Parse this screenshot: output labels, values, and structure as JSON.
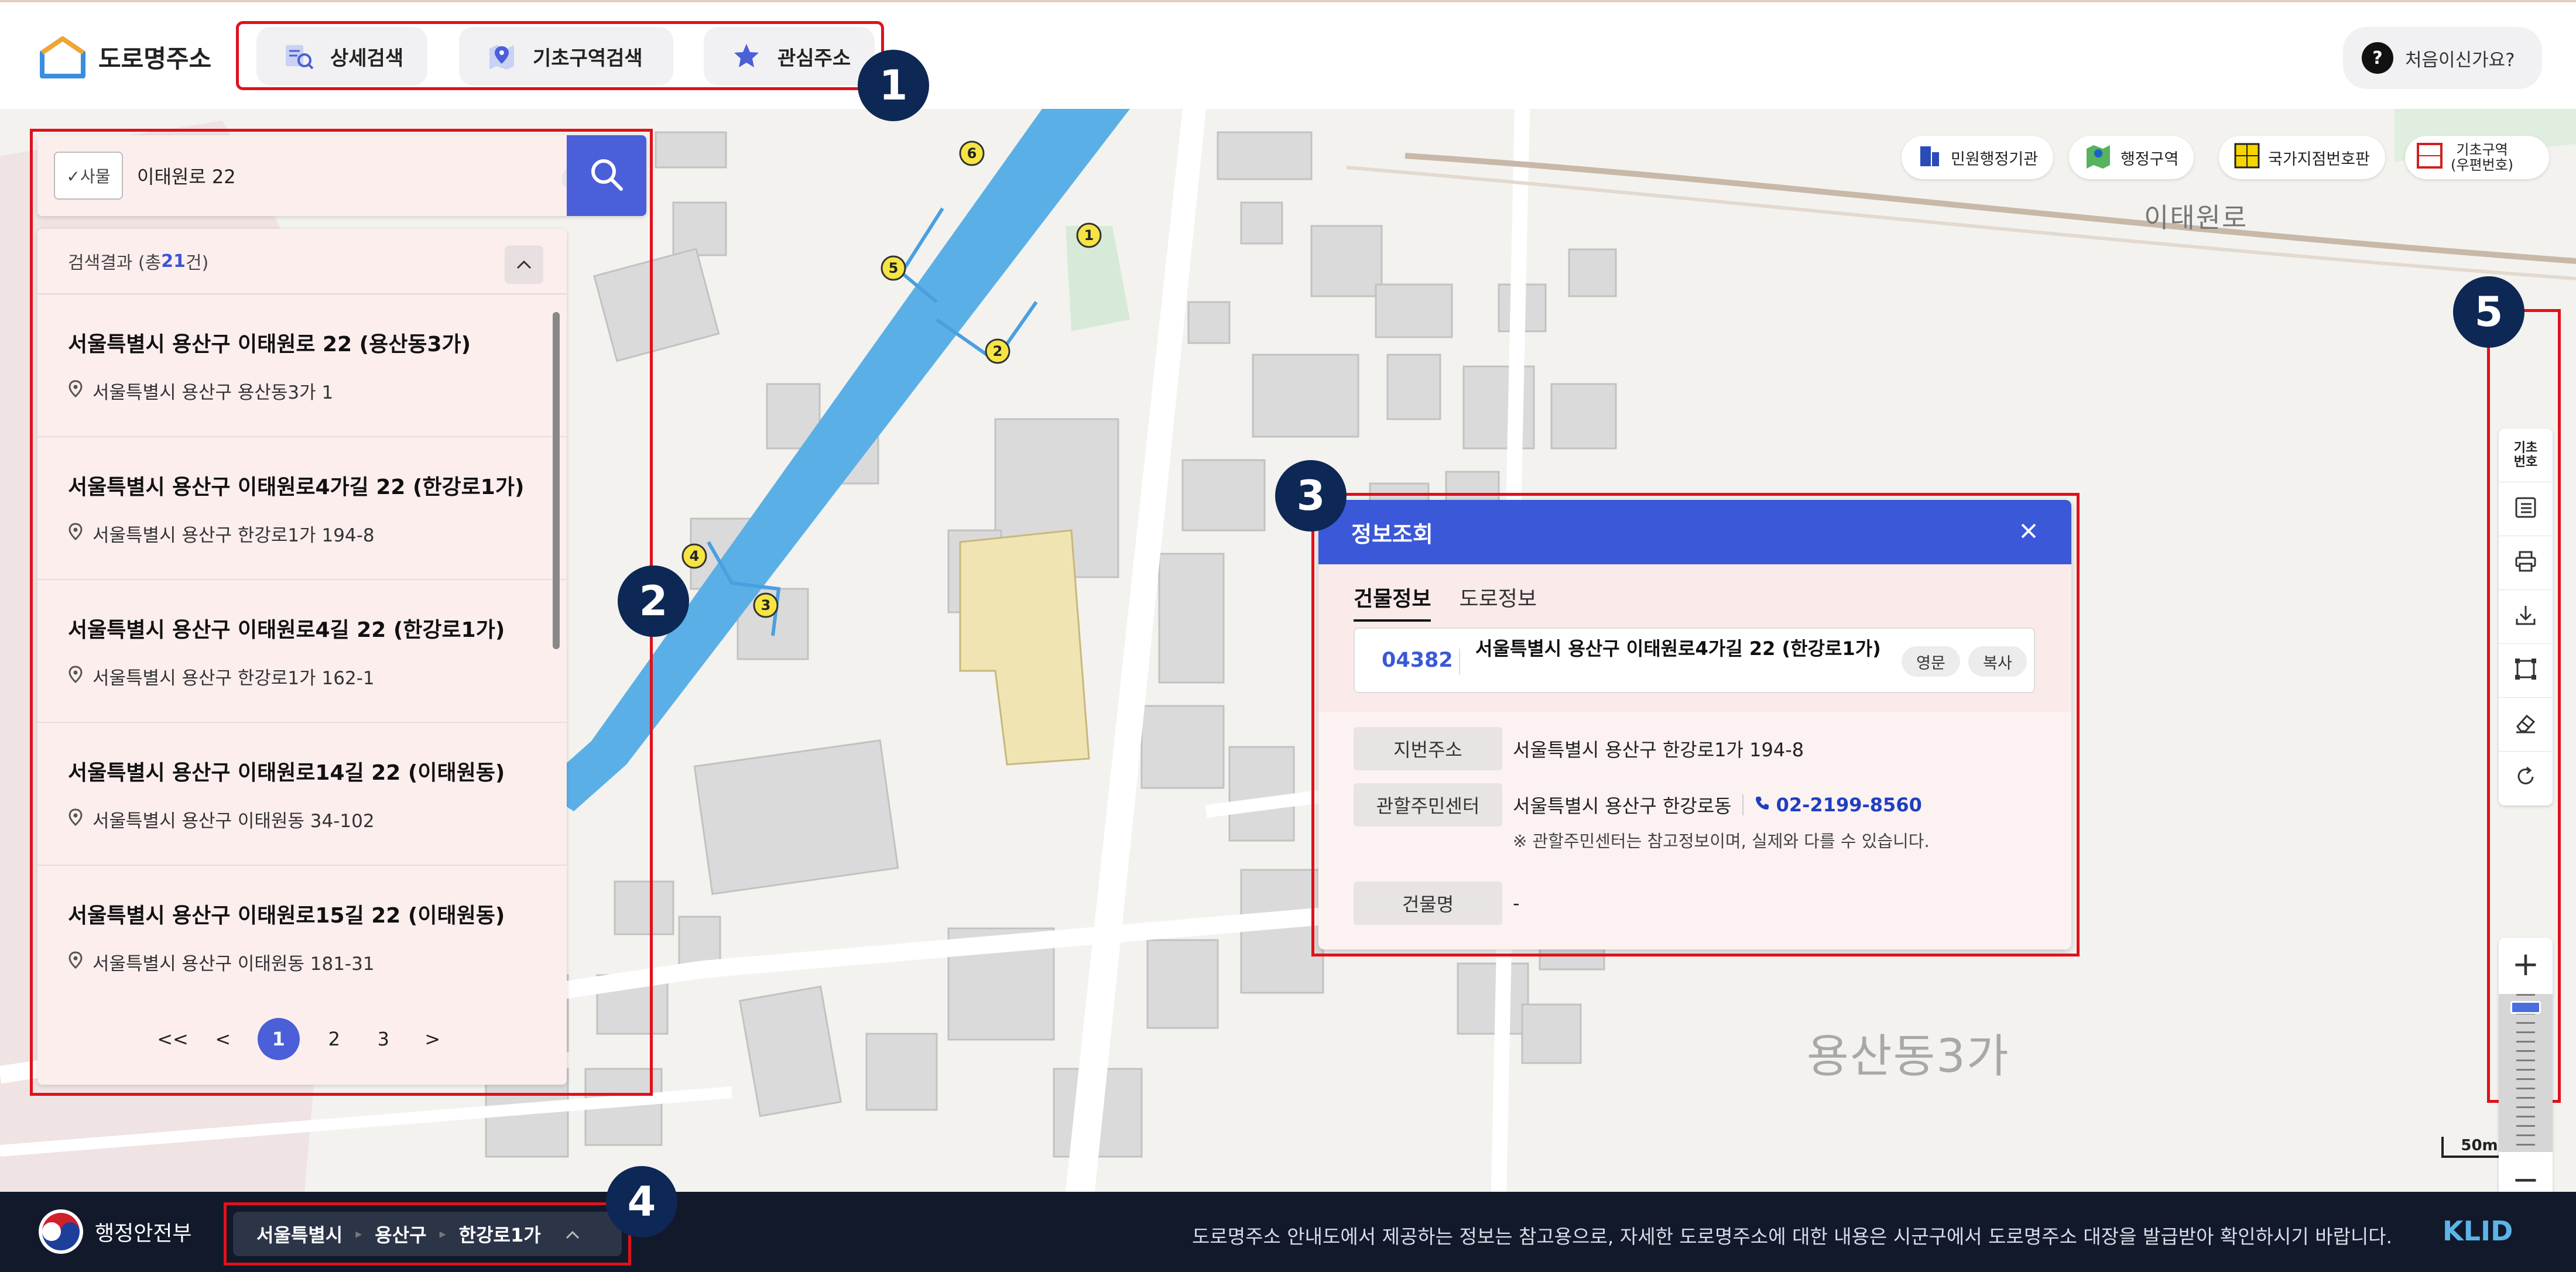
{
  "header": {
    "logo_text": "도로명주소",
    "nav": [
      {
        "label": "상세검색",
        "icon": "search-list-icon"
      },
      {
        "label": "기초구역검색",
        "icon": "map-pin-icon"
      },
      {
        "label": "관심주소",
        "icon": "star-icon"
      }
    ],
    "help_label": "처음이신가요?",
    "help_icon": "?"
  },
  "map": {
    "area_labels": [
      "이태원로",
      "용산동3가"
    ],
    "chips": [
      {
        "label": "민원행정기관",
        "icon": "building-icon"
      },
      {
        "label": "행정구역",
        "icon": "map-icon"
      },
      {
        "label": "국가지점번호판",
        "icon": "grid-sign-icon"
      },
      {
        "label": "기초구역\n(우편번호)",
        "icon": "postal-code-icon"
      }
    ],
    "toolbar": [
      {
        "label": "기초\n번호",
        "icon": "zone-number-icon"
      },
      {
        "label": "",
        "icon": "list-icon"
      },
      {
        "label": "",
        "icon": "print-icon"
      },
      {
        "label": "",
        "icon": "download-icon"
      },
      {
        "label": "",
        "icon": "area-select-icon"
      },
      {
        "label": "",
        "icon": "eraser-icon"
      },
      {
        "label": "",
        "icon": "refresh-icon"
      }
    ],
    "zoom_in": "+",
    "zoom_out": "−",
    "zoom_level_fraction": 0.05,
    "scale_label": "50m"
  },
  "markers": [
    "1",
    "2",
    "3",
    "4",
    "5"
  ],
  "search": {
    "filter_label": "✓사물",
    "query": "이태원로 22",
    "clear_icon": "×",
    "results_prefix": "검색결과 (총 ",
    "results_count": "21",
    "results_suffix": "건)",
    "results": [
      {
        "road": "서울특별시 용산구 이태원로 22 (용산동3가)",
        "jibun": "서울특별시 용산구 용산동3가 1"
      },
      {
        "road": "서울특별시 용산구 이태원로4가길 22 (한강로1가)",
        "jibun": "서울특별시 용산구 한강로1가 194-8"
      },
      {
        "road": "서울특별시 용산구 이태원로4길 22 (한강로1가)",
        "jibun": "서울특별시 용산구 한강로1가 162-1"
      },
      {
        "road": "서울특별시 용산구 이태원로14길 22 (이태원동)",
        "jibun": "서울특별시 용산구 이태원동 34-102"
      },
      {
        "road": "서울특별시 용산구 이태원로15길 22 (이태원동)",
        "jibun": "서울특별시 용산구 이태원동 181-31"
      }
    ],
    "pager": {
      "first": "<<",
      "prev": "<",
      "pages": [
        "1",
        "2",
        "3"
      ],
      "current": "1",
      "next": ">"
    }
  },
  "info": {
    "title": "정보조회",
    "close_icon": "×",
    "tabs": [
      "건물정보",
      "도로정보"
    ],
    "active_tab": "건물정보",
    "zip": "04382",
    "road_address": "서울특별시 용산구 이태원로4가길 22 (한강로1가)",
    "english_label": "영문",
    "copy_label": "복사",
    "rows": [
      {
        "label": "지번주소",
        "value": "서울특별시 용산구 한강로1가 194-8"
      },
      {
        "label": "관할주민센터",
        "value": "서울특별시 용산구 한강로동",
        "phone": "02-2199-8560"
      },
      {
        "label": "건물명",
        "value": "-"
      }
    ],
    "note": "※ 관할주민센터는 참고정보이며, 실제와 다를 수 있습니다."
  },
  "footer": {
    "ministry": "행정안전부",
    "breadcrumb": [
      "서울특별시",
      "용산구",
      "한강로1가"
    ],
    "notice": "도로명주소 안내도에서 제공하는 정보는 참고용으로, 자세한 도로명주소에 대한 내용은 시군구에서 도로명주소 대장을 발급받아 확인하시기 바랍니다.",
    "brand": "KLID"
  },
  "colors": {
    "accent": "#3a58d8",
    "annotation_red": "#e0111b",
    "marker_navy": "#0d2855",
    "footer_bg": "#11192b"
  }
}
